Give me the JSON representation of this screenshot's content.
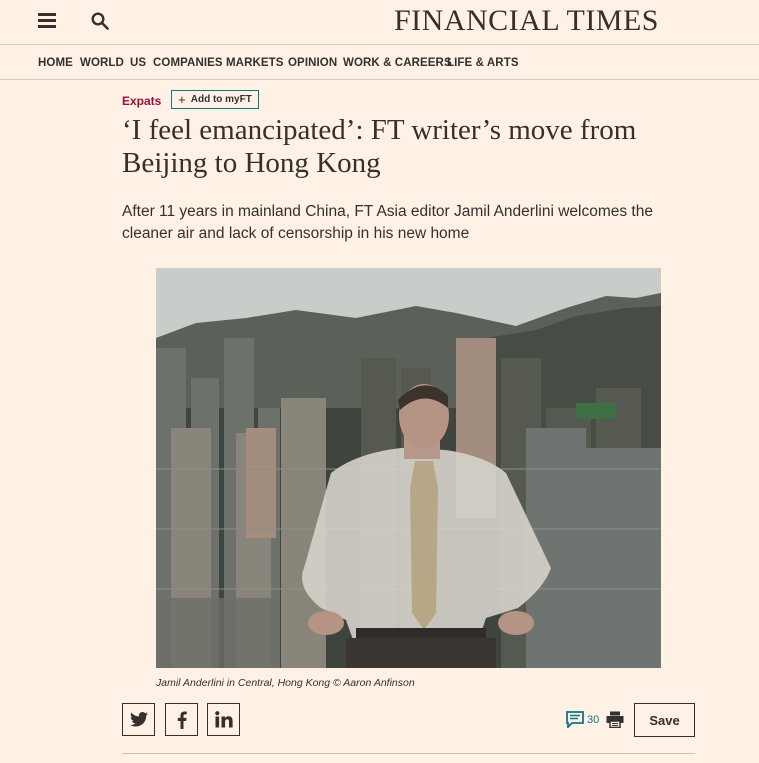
{
  "masthead": "FINANCIAL TIMES",
  "nav": {
    "items": [
      "HOME",
      "WORLD",
      "US",
      "COMPANIES",
      "MARKETS",
      "OPINION",
      "WORK & CAREERS",
      "LIFE & ARTS"
    ]
  },
  "article": {
    "topic": "Expats",
    "add_to_myft": "Add to myFT",
    "headline_line1": "‘I feel emancipated’: FT writer’s move from",
    "headline_line2": "Beijing to Hong Kong",
    "standfirst_line1": "After 11 years in mainland China, FT Asia editor Jamil Anderlini welcomes the",
    "standfirst_line2": "cleaner air and lack of censorship in his new home",
    "caption": "Jamil Anderlini in Central, Hong Kong © Aaron Anfinson"
  },
  "actions": {
    "comment_count": "30",
    "save_label": "Save"
  },
  "colors": {
    "background": "#fff1e5",
    "claret": "#990f3d",
    "teal": "#0d7680",
    "text": "#33302e"
  },
  "icons": [
    "menu-icon",
    "search-icon",
    "twitter-icon",
    "facebook-icon",
    "linkedin-icon",
    "comments-icon",
    "print-icon",
    "plus-icon"
  ]
}
